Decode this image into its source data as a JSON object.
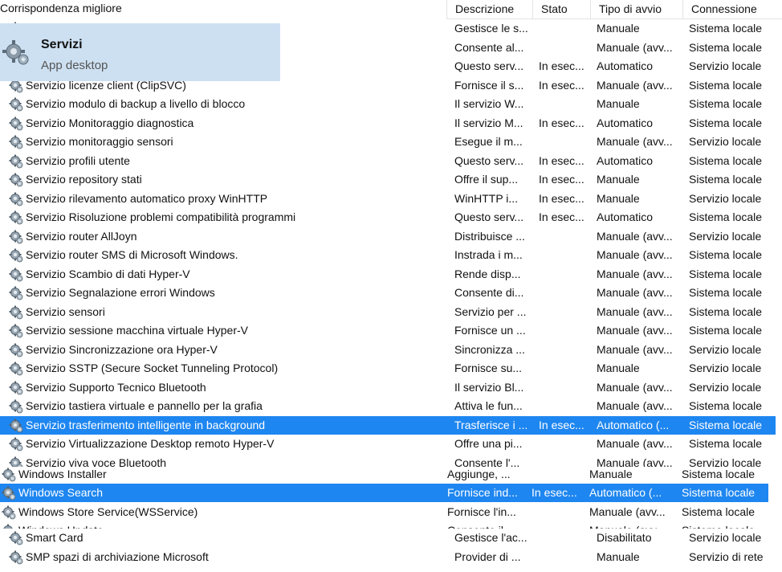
{
  "search": {
    "section_label": "Corrispondenza migliore",
    "best_title": "Servizi",
    "best_subtitle": "App desktop"
  },
  "columns": {
    "description": "Descrizione",
    "status": "Stato",
    "startup": "Tipo di avvio",
    "logon": "Connessione"
  },
  "rows_a": [
    {
      "name": "",
      "desc": "Gestisce le s...",
      "status": "",
      "startup": "Manuale",
      "logon": "Sistema locale"
    },
    {
      "name": "",
      "desc": "Consente al...",
      "status": "",
      "startup": "Manuale (avv...",
      "logon": "Sistema locale"
    },
    {
      "name": "",
      "desc": "Questo serv...",
      "status": "In esec...",
      "startup": "Automatico",
      "logon": "Servizio locale"
    },
    {
      "name": "Servizio licenze client (ClipSVC)",
      "desc": "Fornisce il s...",
      "status": "In esec...",
      "startup": "Manuale (avv...",
      "logon": "Sistema locale"
    },
    {
      "name": "Servizio modulo di backup a livello di blocco",
      "desc": "Il servizio W...",
      "status": "",
      "startup": "Manuale",
      "logon": "Sistema locale"
    },
    {
      "name": "Servizio Monitoraggio diagnostica",
      "desc": "Il servizio M...",
      "status": "In esec...",
      "startup": "Automatico",
      "logon": "Sistema locale"
    },
    {
      "name": "Servizio monitoraggio sensori",
      "desc": "Esegue il m...",
      "status": "",
      "startup": "Manuale (avv...",
      "logon": "Servizio locale"
    },
    {
      "name": "Servizio profili utente",
      "desc": "Questo serv...",
      "status": "In esec...",
      "startup": "Automatico",
      "logon": "Sistema locale"
    },
    {
      "name": "Servizio repository stati",
      "desc": "Offre il sup...",
      "status": "In esec...",
      "startup": "Manuale",
      "logon": "Sistema locale"
    },
    {
      "name": "Servizio rilevamento automatico proxy WinHTTP",
      "desc": "WinHTTP i...",
      "status": "In esec...",
      "startup": "Manuale",
      "logon": "Servizio locale"
    },
    {
      "name": "Servizio Risoluzione problemi compatibilità programmi",
      "desc": "Questo serv...",
      "status": "In esec...",
      "startup": "Automatico",
      "logon": "Sistema locale"
    },
    {
      "name": "Servizio router AllJoyn",
      "desc": "Distribuisce ...",
      "status": "",
      "startup": "Manuale (avv...",
      "logon": "Servizio locale"
    },
    {
      "name": "Servizio router SMS di Microsoft Windows.",
      "desc": "Instrada i m...",
      "status": "",
      "startup": "Manuale (avv...",
      "logon": "Sistema locale"
    },
    {
      "name": "Servizio Scambio di dati Hyper-V",
      "desc": "Rende disp...",
      "status": "",
      "startup": "Manuale (avv...",
      "logon": "Sistema locale"
    },
    {
      "name": "Servizio Segnalazione errori Windows",
      "desc": "Consente di...",
      "status": "",
      "startup": "Manuale (avv...",
      "logon": "Sistema locale"
    },
    {
      "name": "Servizio sensori",
      "desc": "Servizio per ...",
      "status": "",
      "startup": "Manuale (avv...",
      "logon": "Sistema locale"
    },
    {
      "name": "Servizio sessione macchina virtuale Hyper-V",
      "desc": "Fornisce un ...",
      "status": "",
      "startup": "Manuale (avv...",
      "logon": "Sistema locale"
    },
    {
      "name": "Servizio Sincronizzazione ora Hyper-V",
      "desc": "Sincronizza ...",
      "status": "",
      "startup": "Manuale (avv...",
      "logon": "Servizio locale"
    },
    {
      "name": "Servizio SSTP (Secure Socket Tunneling Protocol)",
      "desc": "Fornisce su...",
      "status": "",
      "startup": "Manuale",
      "logon": "Servizio locale"
    },
    {
      "name": "Servizio Supporto Tecnico Bluetooth",
      "desc": "Il servizio Bl...",
      "status": "",
      "startup": "Manuale (avv...",
      "logon": "Servizio locale"
    },
    {
      "name": "Servizio tastiera virtuale e pannello per la grafia",
      "desc": "Attiva le fun...",
      "status": "",
      "startup": "Manuale (avv...",
      "logon": "Sistema locale"
    },
    {
      "name": "Servizio trasferimento intelligente in background",
      "desc": "Trasferisce i ...",
      "status": "In esec...",
      "startup": "Automatico (...",
      "logon": "Sistema locale",
      "selected": true
    },
    {
      "name": "Servizio Virtualizzazione Desktop remoto Hyper-V",
      "desc": "Offre una pi...",
      "status": "",
      "startup": "Manuale (avv...",
      "logon": "Sistema locale"
    },
    {
      "name": "Servizio viva voce Bluetooth",
      "desc": "Consente l'...",
      "status": "",
      "startup": "Manuale (avv...",
      "logon": "Servizio locale"
    }
  ],
  "rows_b": [
    {
      "name": "Windows Installer",
      "desc": "Aggiunge, ...",
      "status": "",
      "startup": "Manuale",
      "logon": "Sistema locale"
    },
    {
      "name": "Windows Search",
      "desc": "Fornisce ind...",
      "status": "In esec...",
      "startup": "Automatico (...",
      "logon": "Sistema locale",
      "selected": true
    },
    {
      "name": "Windows Store Service(WSService)",
      "desc": "Fornisce l'in...",
      "status": "",
      "startup": "Manuale (avv...",
      "logon": "Sistema locale"
    },
    {
      "name": "Windows Update",
      "desc": "Consente il ...",
      "status": "",
      "startup": "Manuale (avv...",
      "logon": "Sistema locale"
    }
  ],
  "rows_c": [
    {
      "name": "Smart Card",
      "desc": "Gestisce l'ac...",
      "status": "",
      "startup": "Disabilitato",
      "logon": "Servizio locale"
    },
    {
      "name": "SMP spazi di archiviazione Microsoft",
      "desc": "Provider di ...",
      "status": "",
      "startup": "Manuale",
      "logon": "Servizio di rete"
    }
  ]
}
